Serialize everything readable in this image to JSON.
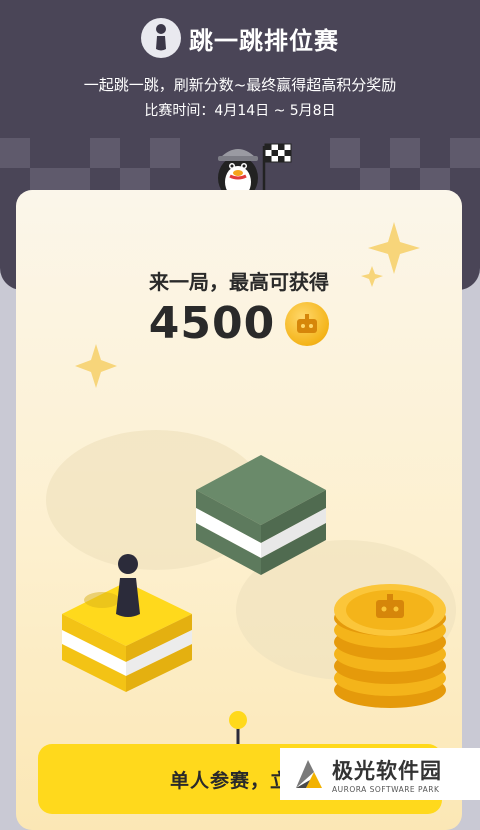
{
  "header": {
    "title": "跳一跳排位赛",
    "subtitle": "一起跳一跳，刷新分数~最终赢得超高积分奖励",
    "dates": "比赛时间：4月14日 ~ 5月8日"
  },
  "card": {
    "headline": "来一局，最高可获得",
    "score": "4500",
    "coin_icon": "robot-coin-icon"
  },
  "cta": {
    "label": "单人参赛，立即"
  },
  "watermark": {
    "brand_cn": "极光软件园",
    "brand_en": "AURORA SOFTWARE PARK"
  },
  "colors": {
    "header_bg": "#4a4557",
    "card_bg": "#fbf6ea",
    "accent_yellow": "#ffd91c",
    "coin_gold": "#f4b41a",
    "block_green": "#6a8a6a"
  }
}
